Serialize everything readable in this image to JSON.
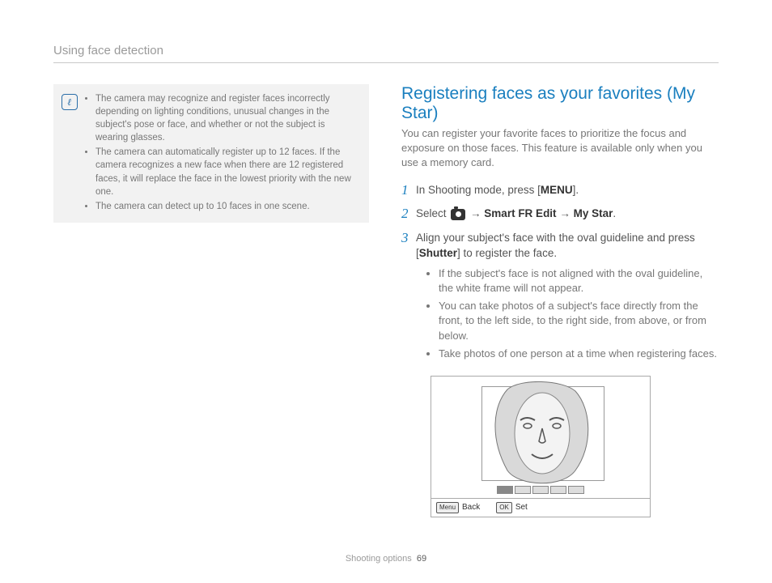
{
  "header": {
    "title": "Using face detection"
  },
  "note": {
    "items": [
      "The camera may recognize and register faces incorrectly depending on lighting conditions, unusual changes in the subject's pose or face, and whether or not the subject is wearing glasses.",
      "The camera can automatically register up to 12 faces. If the camera recognizes a new face when there are 12 registered faces, it will replace the face in the lowest priority with the new one.",
      "The camera can detect up to 10 faces in one scene."
    ]
  },
  "section": {
    "title": "Registering faces as your favorites (My Star)",
    "intro": "You can register your favorite faces to prioritize the focus and exposure on those faces. This feature is available only when you use a memory card."
  },
  "steps": {
    "s1_a": "In Shooting mode, press [",
    "s1_menu": "MENU",
    "s1_b": "].",
    "s2_a": "Select ",
    "s2_arrow1": " → ",
    "s2_b": "Smart FR Edit",
    "s2_arrow2": " → ",
    "s2_c": "My Star",
    "s2_d": ".",
    "s3_a": "Align your subject's face with the oval guideline and press [",
    "s3_shutter": "Shutter",
    "s3_b": "] to register the face.",
    "sub": [
      "If the subject's face is not aligned with the oval guideline, the white frame will not appear.",
      "You can take photos of a subject's face directly from the front, to the left side, to the right side, from above, or from below.",
      "Take photos of one person at a time when registering faces."
    ]
  },
  "screen": {
    "back_btn": "Menu",
    "back_label": "Back",
    "set_btn": "OK",
    "set_label": "Set"
  },
  "footer": {
    "section": "Shooting options",
    "page": "69"
  }
}
